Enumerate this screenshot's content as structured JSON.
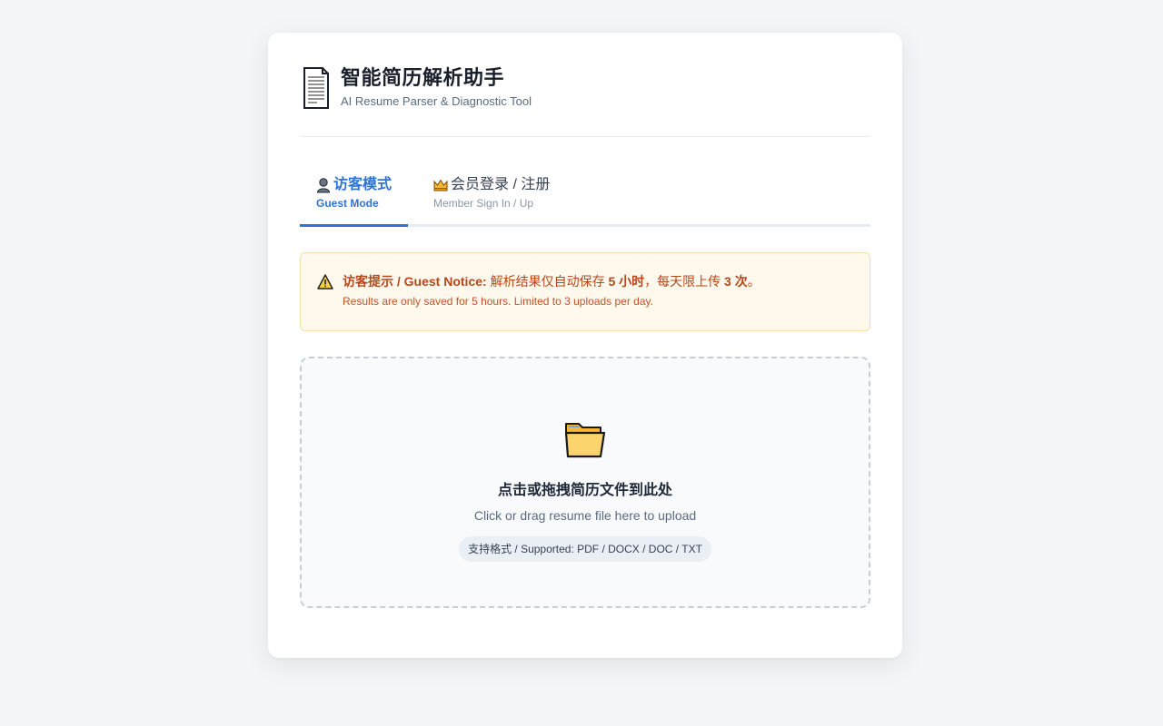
{
  "header": {
    "title": "智能简历解析助手",
    "subtitle": "AI Resume Parser & Diagnostic Tool",
    "icon": "document-icon"
  },
  "tabs": [
    {
      "label": "访客模式",
      "sublabel": "Guest Mode",
      "icon": "guest-icon",
      "active": true
    },
    {
      "label": "会员登录 / 注册",
      "sublabel": "Member Sign In / Up",
      "icon": "crown-icon",
      "active": false
    }
  ],
  "notice": {
    "label": "访客提示 / Guest Notice:",
    "text_before": " 解析结果仅自动保存 ",
    "hours": "5 小时",
    "text_middle": "，每天限上传 ",
    "count": "3 次",
    "text_end": "。",
    "english": "Results are only saved for 5 hours. Limited to 3 uploads per day.",
    "icon": "warning-icon"
  },
  "upload": {
    "title": "点击或拖拽简历文件到此处",
    "subtitle": "Click or drag resume file here to upload",
    "formats": "支持格式 / Supported: PDF / DOCX / DOC / TXT",
    "icon": "folder-icon"
  },
  "colors": {
    "accent": "#2f73d8",
    "notice_bg": "#fff8ec",
    "notice_text": "#b5481a",
    "page_bg": "#f3f5f8"
  }
}
